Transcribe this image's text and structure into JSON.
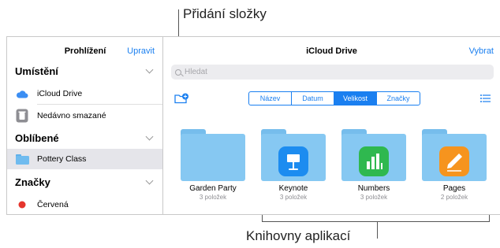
{
  "callouts": {
    "add_folder": "Přidání složky",
    "app_libraries": "Knihovny aplikací"
  },
  "sidebar": {
    "title": "Prohlížení",
    "edit": "Upravit",
    "sections": {
      "locations": "Umístění",
      "favorites": "Oblíbené",
      "tags": "Značky"
    },
    "items": [
      {
        "label": "iCloud Drive",
        "icon": "cloud-icon"
      },
      {
        "label": "Nedávno smazané",
        "icon": "trash-icon"
      },
      {
        "label": "Pottery Class",
        "icon": "folder-icon"
      },
      {
        "label": "Červená",
        "icon": "red-dot-icon"
      }
    ]
  },
  "main": {
    "title": "iCloud Drive",
    "select": "Vybrat",
    "search_placeholder": "Hledat",
    "sort_tabs": [
      "Název",
      "Datum",
      "Velikost",
      "Značky"
    ],
    "active_sort": "Velikost",
    "folders": [
      {
        "name": "Garden Party",
        "count": "3 položek"
      },
      {
        "name": "Keynote",
        "count": "3 položek",
        "app": "keynote"
      },
      {
        "name": "Numbers",
        "count": "3 položek",
        "app": "numbers"
      },
      {
        "name": "Pages",
        "count": "2 položek",
        "app": "pages"
      }
    ]
  },
  "colors": {
    "accent": "#1a7ff0",
    "folder": "#86c8f2",
    "tag_red": "#e5352d"
  }
}
